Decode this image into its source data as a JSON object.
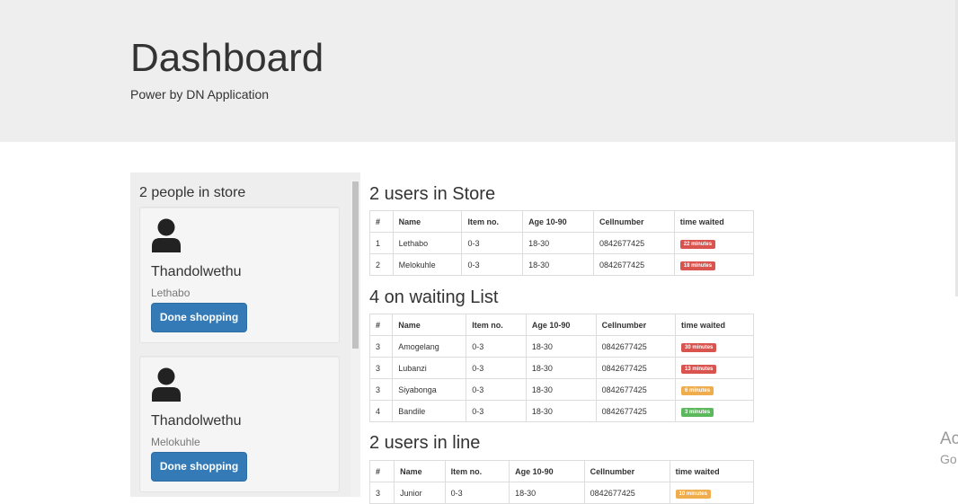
{
  "header": {
    "title": "Dashboard",
    "subtitle": "Power by DN Application"
  },
  "panel": {
    "title": "2 people in store",
    "cards": [
      {
        "name": "Thandolwethu",
        "sub": "Lethabo",
        "button": "Done shopping"
      },
      {
        "name": "Thandolwethu",
        "sub": "Melokuhle",
        "button": "Done shopping"
      }
    ]
  },
  "columns_store": [
    "#",
    "Name",
    "Item no.",
    "Age 10-90",
    "Cellnumber",
    "time waited"
  ],
  "sections": {
    "store": {
      "title": "2 users in Store",
      "rows": [
        {
          "num": "1",
          "name": "Lethabo",
          "item": "0-3",
          "age": "18-30",
          "cell": "0842677425",
          "wait": "22 minutes",
          "color": "#d9534f"
        },
        {
          "num": "2",
          "name": "Melokuhle",
          "item": "0-3",
          "age": "18-30",
          "cell": "0842677425",
          "wait": "18 minutes",
          "color": "#d9534f"
        }
      ]
    },
    "waiting": {
      "title": "4 on waiting List",
      "rows": [
        {
          "num": "3",
          "name": "Amogelang",
          "item": "0-3",
          "age": "18-30",
          "cell": "0842677425",
          "wait": "30 minutes",
          "color": "#d9534f"
        },
        {
          "num": "3",
          "name": "Lubanzi",
          "item": "0-3",
          "age": "18-30",
          "cell": "0842677425",
          "wait": "13 minutes",
          "color": "#d9534f"
        },
        {
          "num": "3",
          "name": "Siyabonga",
          "item": "0-3",
          "age": "18-30",
          "cell": "0842677425",
          "wait": "6 minutes",
          "color": "#f0ad4e"
        },
        {
          "num": "4",
          "name": "Bandile",
          "item": "0-3",
          "age": "18-30",
          "cell": "0842677425",
          "wait": "3 minutes",
          "color": "#5cb85c"
        }
      ]
    },
    "line": {
      "title": "2 users in line",
      "rows": [
        {
          "num": "3",
          "name": "Junior",
          "item": "0-3",
          "age": "18-30",
          "cell": "0842677425",
          "wait": "10 minutes",
          "color": "#f0ad4e"
        }
      ]
    }
  },
  "watermark": {
    "line1": "Ac",
    "line2": "Go"
  }
}
